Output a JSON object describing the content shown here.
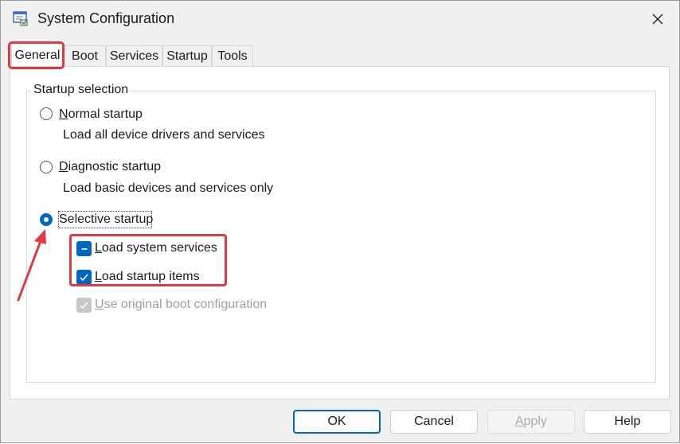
{
  "window": {
    "title": "System Configuration",
    "accent_color": "#0067c0",
    "highlight_color": "#e0393e"
  },
  "tabs": [
    {
      "label": "General",
      "active": true
    },
    {
      "label": "Boot",
      "active": false
    },
    {
      "label": "Services",
      "active": false
    },
    {
      "label": "Startup",
      "active": false
    },
    {
      "label": "Tools",
      "active": false
    }
  ],
  "startup_selection": {
    "legend": "Startup selection",
    "options": [
      {
        "label": "Normal startup",
        "description": "Load all device drivers and services",
        "selected": false
      },
      {
        "label": "Diagnostic startup",
        "description": "Load basic devices and services only",
        "selected": false
      },
      {
        "label": "Selective startup",
        "description": "",
        "selected": true
      }
    ],
    "checkboxes": [
      {
        "label": "Load system services",
        "state": "indeterminate",
        "enabled": true
      },
      {
        "label": "Load startup items",
        "state": "checked",
        "enabled": true
      },
      {
        "label": "Use original boot configuration",
        "state": "checked",
        "enabled": false
      }
    ]
  },
  "buttons": {
    "ok": "OK",
    "cancel": "Cancel",
    "apply": "Apply",
    "help": "Help"
  }
}
